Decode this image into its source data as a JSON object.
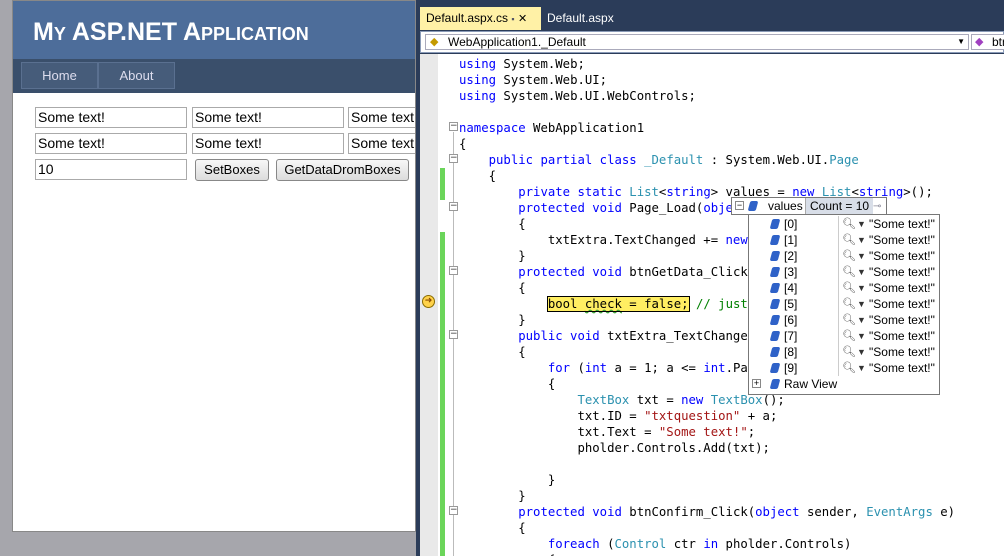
{
  "web": {
    "title": "My ASP.NET Application",
    "nav": [
      "Home",
      "About"
    ],
    "textboxes_row1": [
      "Some text!",
      "Some text!",
      "Some text!"
    ],
    "textboxes_row2": [
      "Some text!",
      "Some text!",
      "Some text!"
    ],
    "extra_value": "10",
    "btn_set": "SetBoxes",
    "btn_get": "GetDataDromBoxes"
  },
  "vs": {
    "tab1": "Default.aspx.cs",
    "tab1_icon": "lock-icon",
    "tab2": "Default.aspx",
    "navbar_class": "WebApplication1._Default",
    "navbar_member": "btn",
    "lines": [
      [
        [
          "using System.Web;",
          "k0"
        ]
      ],
      [
        [
          "using System.Web.UI;",
          "k0"
        ]
      ],
      [
        [
          "using System.Web.UI.WebControls;",
          "k0"
        ]
      ],
      [
        [
          "",
          ""
        ]
      ],
      [
        [
          "namespace",
          "kw"
        ],
        [
          " WebApplication1",
          ""
        ]
      ],
      [
        [
          "{",
          ""
        ]
      ],
      [
        [
          "    ",
          ""
        ],
        [
          "public partial class",
          "kw"
        ],
        [
          " ",
          ""
        ],
        [
          "_Default",
          "ty"
        ],
        [
          " : System.Web.UI.",
          ""
        ],
        [
          "Page",
          "ty"
        ]
      ],
      [
        [
          "    {",
          ""
        ]
      ],
      [
        [
          "        ",
          ""
        ],
        [
          "private static",
          "kw"
        ],
        [
          " ",
          ""
        ],
        [
          "List",
          "ty"
        ],
        [
          "<",
          ""
        ],
        [
          "string",
          "kw"
        ],
        [
          "> values = ",
          ""
        ],
        [
          "new",
          "kw"
        ],
        [
          " ",
          ""
        ],
        [
          "List",
          "ty"
        ],
        [
          "<",
          ""
        ],
        [
          "string",
          "kw"
        ],
        [
          ">();",
          ""
        ]
      ],
      [
        [
          "        ",
          ""
        ],
        [
          "protected void",
          "kw"
        ],
        [
          " Page_Load(",
          ""
        ],
        [
          "object",
          "kw"
        ]
      ],
      [
        [
          "        {",
          ""
        ]
      ],
      [
        [
          "            txtExtra.TextChanged += ",
          ""
        ],
        [
          "new",
          "kw"
        ],
        [
          " Ev",
          ""
        ]
      ],
      [
        [
          "        }",
          ""
        ]
      ],
      [
        [
          "        ",
          ""
        ],
        [
          "protected void",
          "kw"
        ],
        [
          " btnGetData_Click(o",
          ""
        ]
      ],
      [
        [
          "        {",
          ""
        ]
      ],
      [
        [
          "            ",
          ""
        ],
        [
          "bool check = false;",
          "hl"
        ],
        [
          " ",
          ""
        ],
        [
          "// just b",
          "cm"
        ]
      ],
      [
        [
          "        }",
          ""
        ]
      ],
      [
        [
          "        ",
          ""
        ],
        [
          "public void",
          "kw"
        ],
        [
          " txtExtra_TextChanged(",
          ""
        ]
      ],
      [
        [
          "        {",
          ""
        ]
      ],
      [
        [
          "            ",
          ""
        ],
        [
          "for",
          "kw"
        ],
        [
          " (",
          ""
        ],
        [
          "int",
          "kw"
        ],
        [
          " a = 1; a <= ",
          ""
        ],
        [
          "int",
          "kw"
        ],
        [
          ".Pars",
          ""
        ]
      ],
      [
        [
          "            {",
          ""
        ]
      ],
      [
        [
          "                ",
          ""
        ],
        [
          "TextBox",
          "ty"
        ],
        [
          " txt = ",
          ""
        ],
        [
          "new",
          "kw"
        ],
        [
          " ",
          ""
        ],
        [
          "TextBox",
          "ty"
        ],
        [
          "();",
          ""
        ]
      ],
      [
        [
          "                txt.ID = ",
          ""
        ],
        [
          "\"txtquestion\"",
          "st"
        ],
        [
          " + a;",
          ""
        ]
      ],
      [
        [
          "                txt.Text = ",
          ""
        ],
        [
          "\"Some text!\"",
          "st"
        ],
        [
          ";",
          ""
        ]
      ],
      [
        [
          "                pholder.Controls.Add(txt);",
          ""
        ]
      ],
      [
        [
          "",
          ""
        ]
      ],
      [
        [
          "            }",
          ""
        ]
      ],
      [
        [
          "        }",
          ""
        ]
      ],
      [
        [
          "        ",
          ""
        ],
        [
          "protected void",
          "kw"
        ],
        [
          " btnConfirm_Click(",
          ""
        ],
        [
          "object",
          "kw"
        ],
        [
          " sender, ",
          ""
        ],
        [
          "EventArgs",
          "ty"
        ],
        [
          " e)",
          ""
        ]
      ],
      [
        [
          "        {",
          ""
        ]
      ],
      [
        [
          "            ",
          ""
        ],
        [
          "foreach",
          "kw"
        ],
        [
          " (",
          ""
        ],
        [
          "Control",
          "ty"
        ],
        [
          " ctr ",
          ""
        ],
        [
          "in",
          "kw"
        ],
        [
          " pholder.Controls)",
          ""
        ]
      ],
      [
        [
          "            {",
          ""
        ]
      ]
    ],
    "tip": {
      "name": "values",
      "count": "Count = 10",
      "indices": [
        "[0]",
        "[1]",
        "[2]",
        "[3]",
        "[4]",
        "[5]",
        "[6]",
        "[7]",
        "[8]",
        "[9]"
      ],
      "values": [
        "\"Some text!\"",
        "\"Some text!\"",
        "\"Some text!\"",
        "\"Some text!\"",
        "\"Some text!\"",
        "\"Some text!\"",
        "\"Some text!\"",
        "\"Some text!\"",
        "\"Some text!\"",
        "\"Some text!\""
      ],
      "raw_view": "Raw View"
    }
  }
}
